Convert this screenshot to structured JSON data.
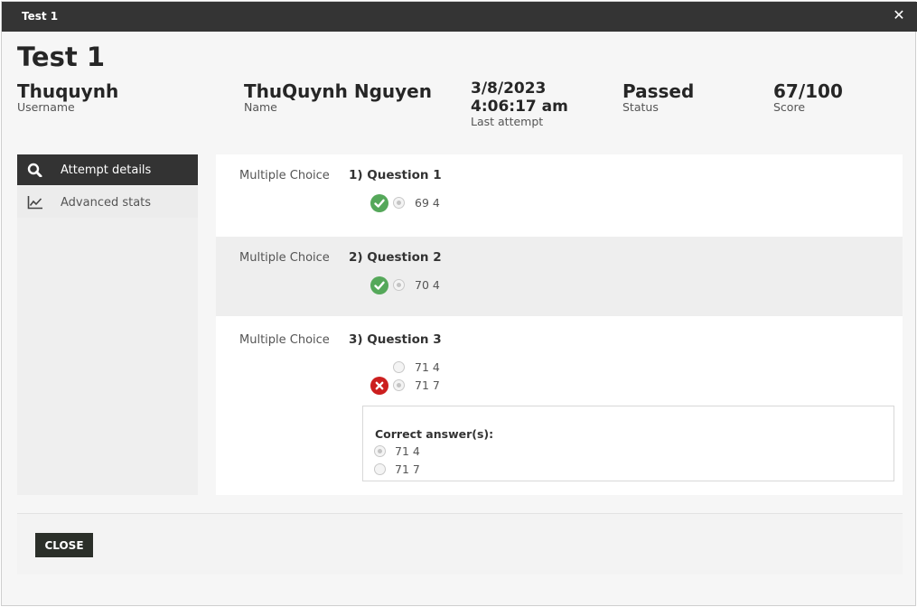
{
  "window": {
    "title": "Test 1"
  },
  "page": {
    "title": "Test 1"
  },
  "summary": {
    "username": {
      "value": "Thuquynh",
      "label": "Username"
    },
    "name": {
      "value": "ThuQuynh Nguyen",
      "label": "Name"
    },
    "last_attempt": {
      "date": "3/8/2023",
      "time": "4:06:17 am",
      "label": "Last attempt"
    },
    "status": {
      "value": "Passed",
      "label": "Status"
    },
    "score": {
      "value": "67/100",
      "label": "Score"
    }
  },
  "sidebar": {
    "items": [
      {
        "label": "Attempt details",
        "icon": "search-icon",
        "active": true
      },
      {
        "label": "Advanced stats",
        "icon": "line-chart-icon",
        "active": false
      }
    ]
  },
  "questions": [
    {
      "type": "Multiple Choice",
      "title": "1) Question 1",
      "answers": [
        {
          "text": "69 4",
          "selected": true,
          "result": "correct"
        }
      ]
    },
    {
      "type": "Multiple Choice",
      "title": "2) Question 2",
      "answers": [
        {
          "text": "70 4",
          "selected": true,
          "result": "correct"
        }
      ]
    },
    {
      "type": "Multiple Choice",
      "title": "3) Question 3",
      "answers": [
        {
          "text": "71 4",
          "selected": false,
          "result": ""
        },
        {
          "text": "71 7",
          "selected": true,
          "result": "wrong"
        }
      ],
      "correct_answers": {
        "label": "Correct answer(s):",
        "options": [
          {
            "text": "71 4",
            "selected": true
          },
          {
            "text": "71 7",
            "selected": false
          }
        ]
      }
    }
  ],
  "footer": {
    "close_label": "CLOSE"
  },
  "colors": {
    "titlebar": "#343434",
    "correct": "#55a85a",
    "wrong": "#cc1f1f",
    "close_button": "#2b2f29"
  }
}
